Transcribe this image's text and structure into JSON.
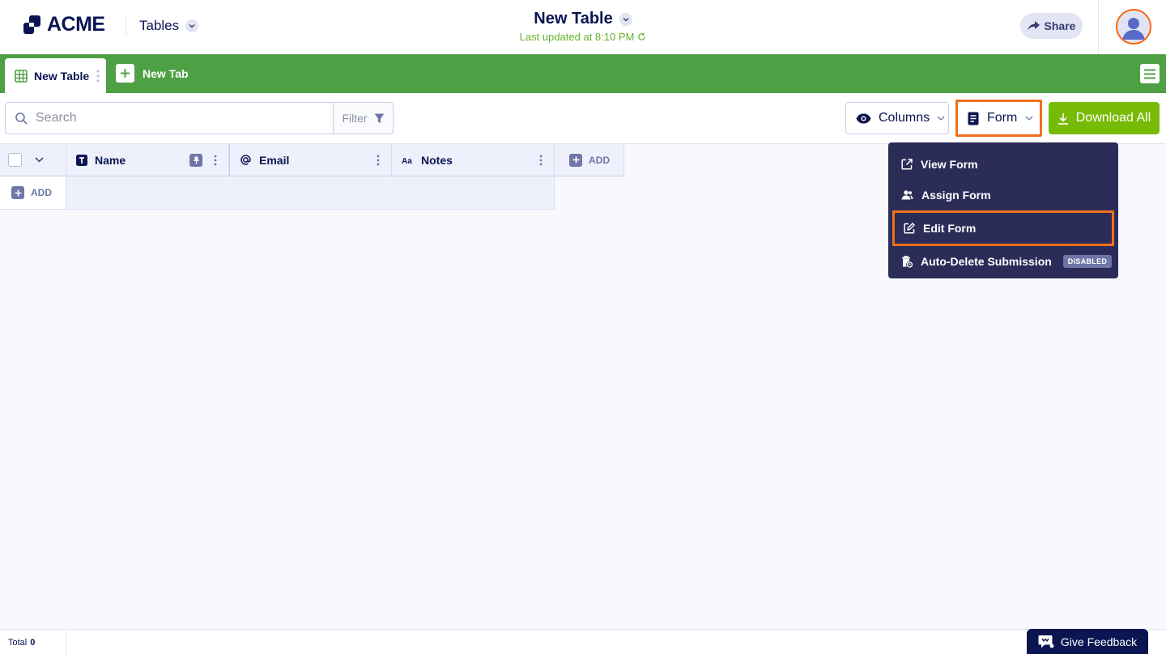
{
  "header": {
    "logo_text": "ACME",
    "section_label": "Tables",
    "document_title": "New Table",
    "last_updated": "Last updated at 8:10 PM",
    "share_label": "Share"
  },
  "tabs": {
    "active_tab": "New Table",
    "new_tab_label": "New Tab"
  },
  "toolbar": {
    "search_placeholder": "Search",
    "filter_label": "Filter",
    "columns_label": "Columns",
    "form_label": "Form",
    "download_label": "Download All"
  },
  "table": {
    "columns": [
      {
        "label": "Name",
        "icon": "text-type-icon"
      },
      {
        "label": "Email",
        "icon": "at-sign-icon"
      },
      {
        "label": "Notes",
        "icon": "aa-text-icon"
      }
    ],
    "add_column_label": "ADD",
    "add_row_label": "ADD"
  },
  "form_menu": {
    "items": [
      {
        "label": "View Form",
        "icon": "external-link-icon"
      },
      {
        "label": "Assign Form",
        "icon": "users-icon"
      },
      {
        "label": "Edit Form",
        "icon": "edit-icon"
      },
      {
        "label": "Auto-Delete Submission",
        "icon": "trash-clock-icon",
        "badge": "DISABLED"
      }
    ]
  },
  "footer": {
    "total_label": "Total",
    "total_value": "0",
    "feedback_label": "Give Feedback"
  },
  "colors": {
    "brand_navy": "#0a1551",
    "tab_bar_green": "#4fa044",
    "download_green": "#78bb07",
    "highlight_orange": "#f06f1d",
    "dropdown_bg": "#2b2d58"
  }
}
